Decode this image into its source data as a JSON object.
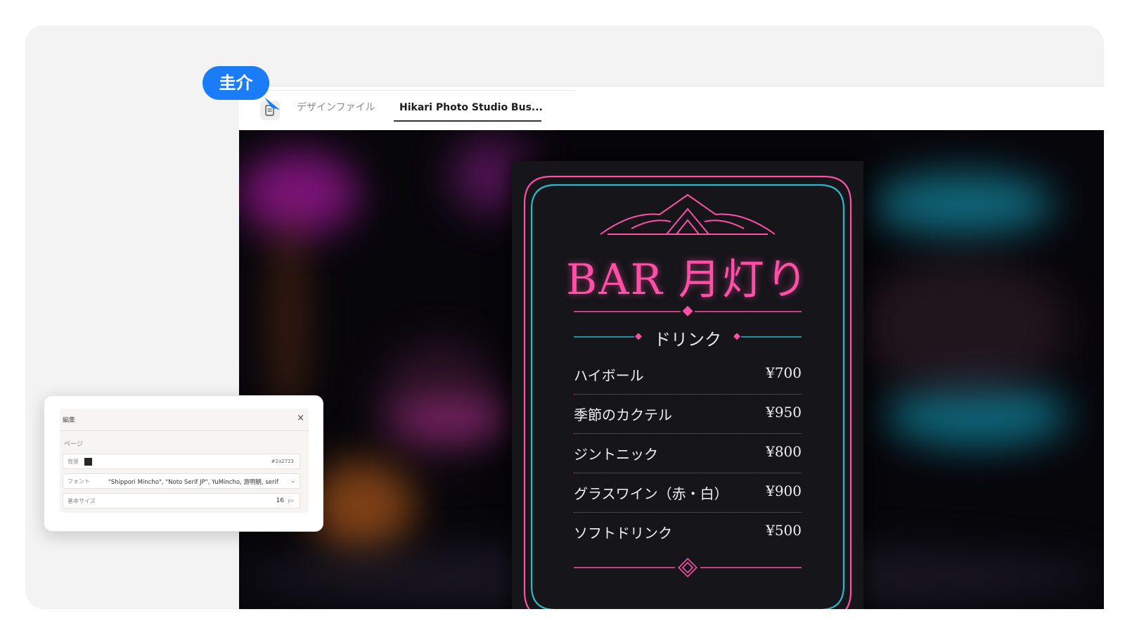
{
  "user": {
    "name": "圭介"
  },
  "tabs": [
    {
      "label": "デザインファイル",
      "active": false
    },
    {
      "label": "Hikari Photo Studio Bus...",
      "active": true
    }
  ],
  "menu": {
    "title": "BAR 月灯り",
    "section": "ドリンク",
    "items": [
      {
        "name": "ハイボール",
        "price": "¥700"
      },
      {
        "name": "季節のカクテル",
        "price": "¥950"
      },
      {
        "name": "ジントニック",
        "price": "¥800"
      },
      {
        "name": "グラスワイン（赤・白）",
        "price": "¥900"
      },
      {
        "name": "ソフトドリンク",
        "price": "¥500"
      }
    ],
    "colors": {
      "pink": "#ff4fa6",
      "teal": "#2fb7c9",
      "board": "#15151a"
    }
  },
  "edit_panel": {
    "title": "編集",
    "close": "×",
    "section": "ページ",
    "background_label": "背景",
    "background_value": "#2a2723",
    "font_label": "フォント",
    "font_value": "\"Shippori Mincho\", \"Noto Serif JP\", YuMincho, 游明朝, serif",
    "font_chevron": "⌄",
    "size_label": "基本サイズ",
    "size_value": "16",
    "size_unit": "px"
  },
  "icons": {
    "tab_icon": "file-icon",
    "cursor": "cursor-pointer-icon"
  }
}
